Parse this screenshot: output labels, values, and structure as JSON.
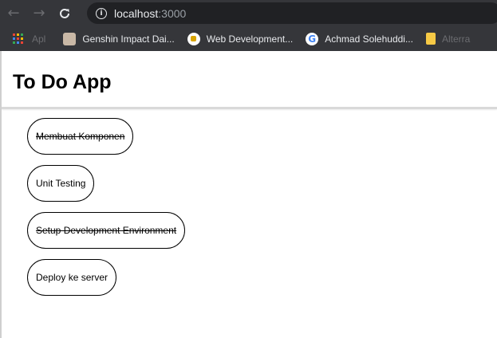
{
  "browser": {
    "url_host": "localhost",
    "url_port": ":3000",
    "bookmarks": [
      {
        "label": "Apl",
        "icon": "apps-grid-icon"
      },
      {
        "label": "Genshin Impact Dai...",
        "icon": "genshin-favicon"
      },
      {
        "label": "Web Development...",
        "icon": "webdev-favicon"
      },
      {
        "label": "Achmad Solehuddi...",
        "icon": "google-favicon"
      },
      {
        "label": "Alterra",
        "icon": "folder-icon"
      }
    ]
  },
  "app": {
    "title": "To Do App",
    "todos": [
      {
        "title": "Membuat Komponen",
        "completed": true
      },
      {
        "title": "Unit Testing",
        "completed": false
      },
      {
        "title": "Setup Development Environment",
        "completed": true
      },
      {
        "title": "Deploy ke server",
        "completed": false
      }
    ]
  },
  "colors": {
    "chrome_bg": "#35363a",
    "omnibox_bg": "#202124",
    "chrome_text": "#e8eaed",
    "muted_text": "#9aa0a6"
  }
}
